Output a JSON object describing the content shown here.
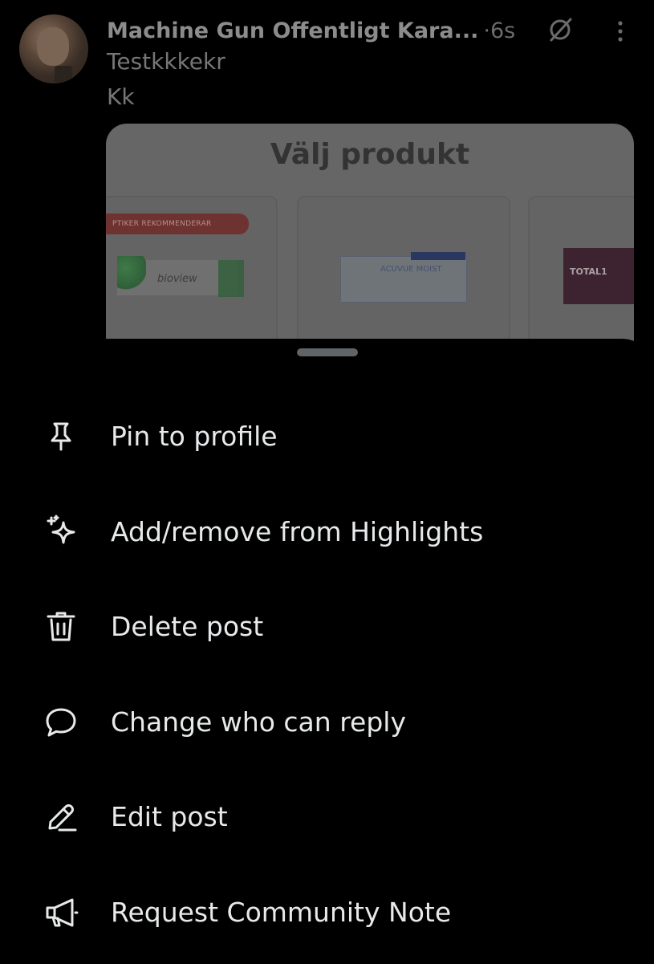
{
  "post": {
    "author": "Machine Gun Offentligt Kara...",
    "separator": "·",
    "time": "6s",
    "handle": "Testkkkekr",
    "text": "Kk",
    "media": {
      "title": "Välj produkt",
      "badge": "PTIKER REKOMMENDERAR",
      "product1": "bioview",
      "product2": "ACUVUE MOIST",
      "product3": "TOTAL1"
    }
  },
  "sheet": {
    "items": [
      {
        "label": "Pin to profile",
        "icon": "pin-icon"
      },
      {
        "label": "Add/remove from Highlights",
        "icon": "sparkle-icon"
      },
      {
        "label": "Delete post",
        "icon": "trash-icon"
      },
      {
        "label": "Change who can reply",
        "icon": "speech-bubble-icon"
      },
      {
        "label": "Edit post",
        "icon": "pencil-icon"
      },
      {
        "label": "Request Community Note",
        "icon": "megaphone-icon"
      }
    ]
  },
  "colors": {
    "background": "#000000",
    "menu_text": "#e7e9ea",
    "dimmed_text": "#767676"
  }
}
